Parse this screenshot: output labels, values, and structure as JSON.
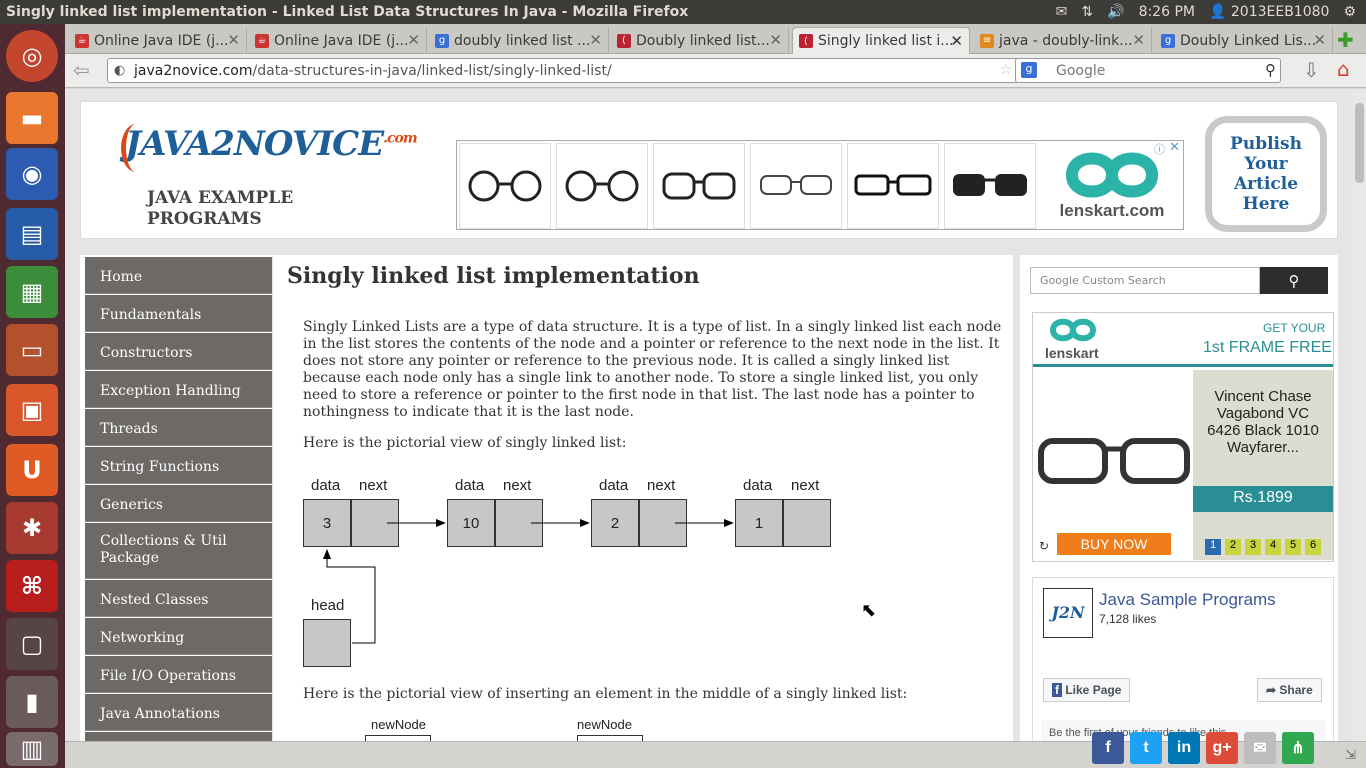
{
  "window": {
    "title": "Singly linked list implementation - Linked List Data Structures In Java - Mozilla Firefox"
  },
  "tray": {
    "time": "8:26 PM",
    "user": "2013EEB1080"
  },
  "tabs": [
    {
      "label": "Online Java IDE (j..."
    },
    {
      "label": "Online Java IDE (j..."
    },
    {
      "label": "doubly linked list ..."
    },
    {
      "label": "Doubly linked list..."
    },
    {
      "label": "Singly linked list i..."
    },
    {
      "label": "java - doubly-link..."
    },
    {
      "label": "Doubly Linked Lis..."
    }
  ],
  "address": {
    "domain": "java2novice.com",
    "path": "/data-structures-in-java/linked-list/singly-linked-list/"
  },
  "search": {
    "placeholder": "Google"
  },
  "site": {
    "logo": "JAVA2NOVICE",
    "logo_suffix": ".com",
    "tagline_1": "JAVA EXAMPLE",
    "tagline_2": "PROGRAMS",
    "publish": "Publish Your Article Here",
    "ad_brand": "lenskart.com"
  },
  "nav": [
    "Home",
    "Fundamentals",
    "Constructors",
    "Exception Handling",
    "Threads",
    "String Functions",
    "Generics",
    "Collections & Util Package",
    "Nested Classes",
    "Networking",
    "File I/O Operations",
    "Java Annotations"
  ],
  "article": {
    "title": "Singly linked list implementation",
    "intro": "Singly Linked Lists are a type of data structure. It is a type of list. In a singly linked list each node in the list stores the contents of the node and a pointer or reference to the next node in the list. It does not store any pointer or reference to the previous node. It is called a singly linked list because each node only has a single link to another node. To store a single linked list, you only need to store a reference or pointer to the first node in that list. The last node has a pointer to nothingness to indicate that it is the last node.",
    "pictorial": "Here is the pictorial view of singly linked list:",
    "insert_caption": "Here is the pictorial view of inserting an element in the middle of a singly linked list:",
    "diagram": {
      "data_label": "data",
      "next_label": "next",
      "head_label": "head",
      "values": [
        "3",
        "10",
        "2",
        "1"
      ],
      "new_node_label": "newNode"
    }
  },
  "right": {
    "cse_placeholder": "Custom Search",
    "cse_brand": "Google",
    "ad": {
      "brand": "lenskart",
      "offer_1": "GET YOUR",
      "offer_2": "1st FRAME FREE",
      "product": "Vincent Chase Vagabond VC 6426 Black 1010 Wayfarer...",
      "price": "Rs.1899",
      "cta": "BUY NOW",
      "pages": [
        "1",
        "2",
        "3",
        "4",
        "5",
        "6"
      ]
    },
    "fb": {
      "page": "Java Sample Programs",
      "likes": "7,128 likes",
      "like": "Like Page",
      "share": "Share",
      "friends": "Be the first of your friends to like this",
      "badge": "J2N"
    }
  },
  "colors": {
    "accent": "#1f5f99",
    "nav_bg": "#6d6966",
    "ad_teal": "#2a8f95",
    "buy_orange": "#f07c1a"
  }
}
